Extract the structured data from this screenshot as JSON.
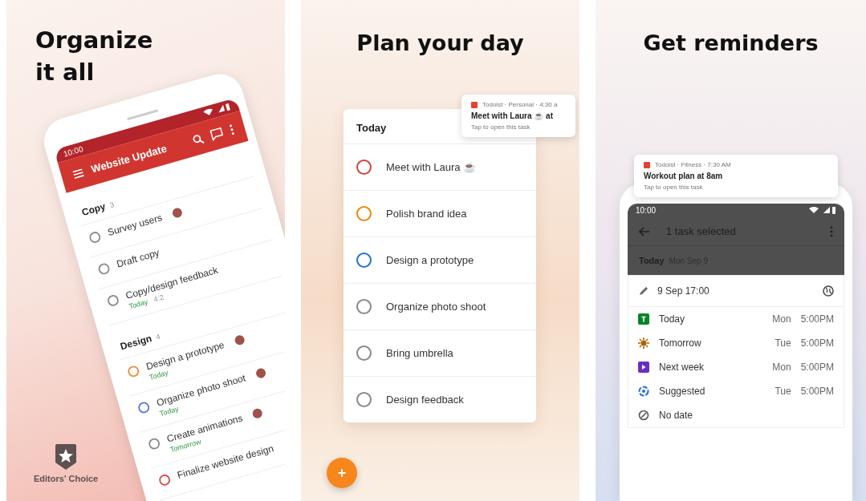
{
  "panels": [
    {
      "kind": "project",
      "headline": "Organize it all",
      "badge": "Editors' Choice",
      "phone": {
        "time": "10:00",
        "title": "Website Update",
        "sections": [
          {
            "name": "Copy",
            "count": "3",
            "tasks": [
              {
                "title": "Survey users",
                "checked": false,
                "avatar": true
              },
              {
                "title": "Draft copy",
                "checked": false,
                "avatar": false
              },
              {
                "title": "Copy/design feedback",
                "due": "Today",
                "extra": "4:2",
                "checked": false,
                "avatar": false
              }
            ]
          },
          {
            "name": "Design",
            "count": "4",
            "tasks": [
              {
                "title": "Design a prototype",
                "due": "Today",
                "color": "#f08a2c",
                "checked": false,
                "avatar": true
              },
              {
                "title": "Organize photo shoot",
                "due": "Today",
                "color": "#4a74e0",
                "checked": false,
                "avatar": true
              },
              {
                "title": "Create animations",
                "due": "Tomorrow",
                "checked": false,
                "avatar": true
              },
              {
                "title": "Finalize website design",
                "color": "#d9473c",
                "checked": false,
                "avatar": false
              }
            ]
          }
        ]
      }
    },
    {
      "kind": "today",
      "headline": "Plan your day",
      "fab": "+",
      "notification": {
        "meta": "Todoist · Personal · 4:30 a",
        "title": "Meet with Laura ☕ at",
        "sub": "Tap to open this task"
      },
      "card": {
        "title": "Today",
        "tasks": [
          {
            "title": "Meet with Laura ☕",
            "color": "#d1453b",
            "checked": false
          },
          {
            "title": "Polish brand idea",
            "color": "#eb8909",
            "checked": false
          },
          {
            "title": "Design a prototype",
            "color": "#246fe0",
            "checked": false
          },
          {
            "title": "Organize photo shoot",
            "checked": false
          },
          {
            "title": "Bring umbrella",
            "checked": false
          },
          {
            "title": "Design feedback",
            "checked": false
          }
        ]
      }
    },
    {
      "kind": "reminders",
      "headline": "Get reminders",
      "notification": {
        "meta": "Todoist · Fitness · 7:30 AM",
        "title": "Workout plan at 8am",
        "sub": "Tap to open this task"
      },
      "phone": {
        "time": "10:00",
        "bar_title": "1 task selected",
        "day": "Today",
        "date": "Mon Sep 9",
        "field": "9 Sep 17:00",
        "options": [
          {
            "kind": "today",
            "label": "Today",
            "day": "Mon",
            "time": "5:00PM",
            "color": "#058527"
          },
          {
            "kind": "tomorrow",
            "label": "Tomorrow",
            "day": "Tue",
            "time": "5:00PM",
            "color": "#ad6200"
          },
          {
            "kind": "week",
            "label": "Next week",
            "day": "Mon",
            "time": "5:00PM",
            "color": "#692fc2"
          },
          {
            "kind": "suggested",
            "label": "Suggested",
            "day": "Tue",
            "time": "5:00PM",
            "color": "#246fe0"
          },
          {
            "kind": "none",
            "label": "No date",
            "color": "#555555"
          }
        ]
      }
    }
  ]
}
